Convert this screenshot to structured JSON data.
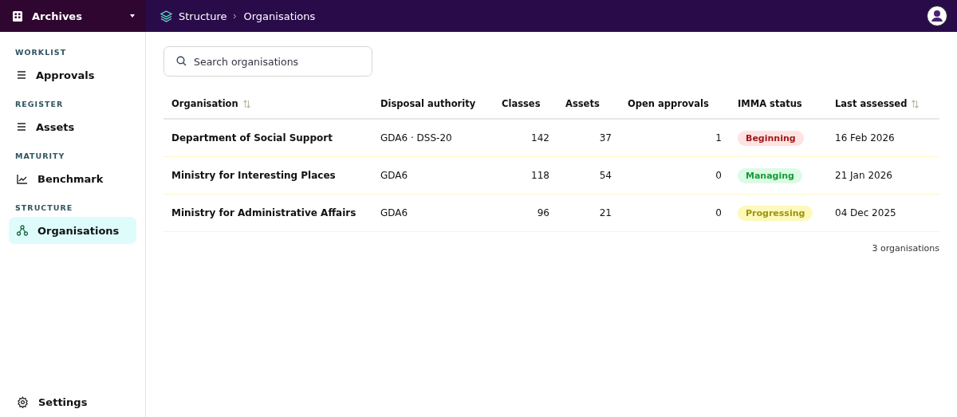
{
  "workspace": {
    "name": "Archives"
  },
  "breadcrumb": [
    "Structure",
    "Organisations"
  ],
  "sidebar": {
    "sections": [
      {
        "title": "WORKLIST",
        "items": [
          {
            "label": "Approvals",
            "selected": false
          }
        ]
      },
      {
        "title": "REGISTER",
        "items": [
          {
            "label": "Assets",
            "selected": false
          }
        ]
      },
      {
        "title": "MATURITY",
        "items": [
          {
            "label": "Benchmark",
            "selected": false
          }
        ]
      },
      {
        "title": "STRUCTURE",
        "items": [
          {
            "label": "Organisations",
            "selected": true
          }
        ]
      }
    ],
    "footer": {
      "label": "Settings"
    }
  },
  "search": {
    "placeholder": "Search organisations"
  },
  "table": {
    "columns": [
      {
        "label": "Organisation",
        "kind": "text",
        "sortable": true
      },
      {
        "label": "Disposal authority",
        "kind": "text",
        "sortable": false
      },
      {
        "label": "Classes",
        "kind": "number",
        "sortable": false
      },
      {
        "label": "Assets",
        "kind": "number",
        "sortable": false
      },
      {
        "label": "Open approvals",
        "kind": "number",
        "sortable": false
      },
      {
        "label": "IMMA status",
        "kind": "status",
        "sortable": false
      },
      {
        "label": "Last assessed",
        "kind": "text",
        "sortable": true
      }
    ],
    "rows": [
      {
        "cells": [
          "Department of Social Support",
          "GDA6 · DSS-20",
          "142",
          "37",
          "1",
          "Beginning",
          "16 Feb 2026"
        ],
        "color": "#ffe3e3"
      },
      {
        "cells": [
          "Ministry for Interesting Places",
          "GDA6",
          "118",
          "54",
          "0",
          "Managing",
          "21 Jan 2026"
        ],
        "color": "#dcfbe4"
      },
      {
        "cells": [
          "Ministry for Administrative Affairs",
          "GDA6",
          "96",
          "21",
          "0",
          "Progressing",
          "04 Dec 2025"
        ],
        "color": "#fdf9b8"
      }
    ]
  },
  "footer_count": "3 organisations"
}
